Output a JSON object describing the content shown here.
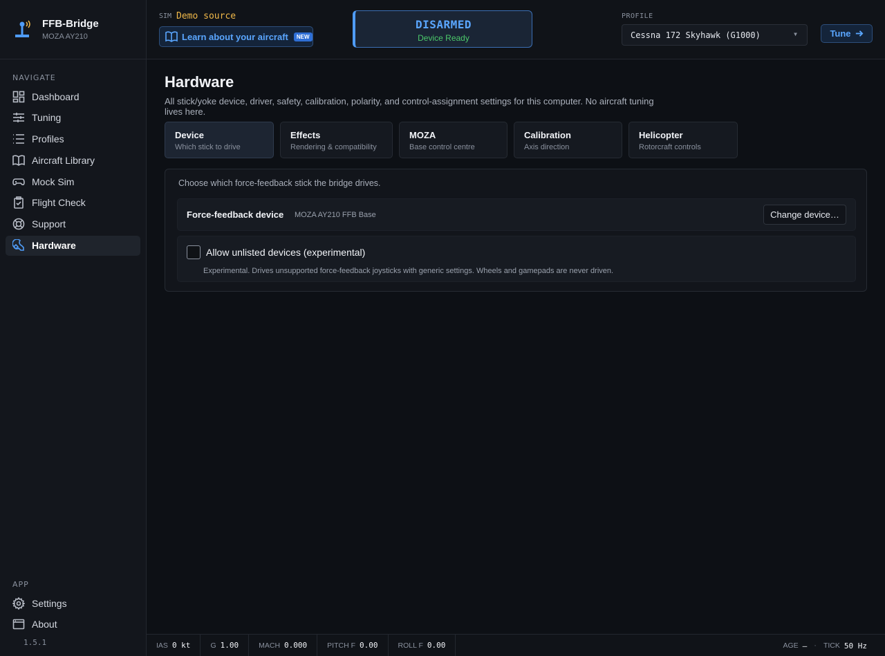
{
  "brand": {
    "title": "FFB-Bridge",
    "subtitle": "MOZA AY210"
  },
  "sidebar": {
    "navigate_label": "NAVIGATE",
    "items": [
      {
        "label": "Dashboard",
        "icon": "dashboard-icon"
      },
      {
        "label": "Tuning",
        "icon": "sliders-icon"
      },
      {
        "label": "Profiles",
        "icon": "list-icon"
      },
      {
        "label": "Aircraft Library",
        "icon": "book-icon"
      },
      {
        "label": "Mock Sim",
        "icon": "gamepad-icon"
      },
      {
        "label": "Flight Check",
        "icon": "clipboard-check-icon"
      },
      {
        "label": "Support",
        "icon": "lifebuoy-icon"
      },
      {
        "label": "Hardware",
        "icon": "wrench-icon",
        "active": true
      }
    ],
    "app_label": "APP",
    "app_items": [
      {
        "label": "Settings",
        "icon": "gear-icon"
      },
      {
        "label": "About",
        "icon": "window-icon"
      }
    ],
    "version": "1.5.1"
  },
  "topbar": {
    "sim_label": "SIM",
    "sim_value": "Demo source",
    "learn_label": "Learn about your aircraft",
    "new_badge": "NEW",
    "status_main": "DISARMED",
    "status_sub": "Device Ready",
    "profile_label": "PROFILE",
    "profile_value": "Cessna 172 Skyhawk (G1000)",
    "tune_label": "Tune"
  },
  "page": {
    "title": "Hardware",
    "description": "All stick/yoke device, driver, safety, calibration, polarity, and control-assignment settings for this computer. No aircraft tuning lives here.",
    "tabs": [
      {
        "title": "Device",
        "sub": "Which stick to drive",
        "active": true
      },
      {
        "title": "Effects",
        "sub": "Rendering & compatibility"
      },
      {
        "title": "MOZA",
        "sub": "Base control centre"
      },
      {
        "title": "Calibration",
        "sub": "Axis direction"
      },
      {
        "title": "Helicopter",
        "sub": "Rotorcraft controls"
      }
    ],
    "card": {
      "intro": "Choose which force-feedback stick the bridge drives.",
      "device_label": "Force-feedback device",
      "device_value": "MOZA AY210 FFB Base",
      "change_label": "Change device…",
      "unlisted_label": "Allow unlisted devices (experimental)",
      "unlisted_checked": false,
      "unlisted_help": "Experimental. Drives unsupported force-feedback joysticks with generic settings. Wheels and gamepads are never driven."
    }
  },
  "footer": {
    "stats": [
      {
        "key": "IAS",
        "value": "0 kt"
      },
      {
        "key": "G",
        "value": "1.00"
      },
      {
        "key": "MACH",
        "value": "0.000"
      },
      {
        "key": "PITCH F",
        "value": "0.00"
      },
      {
        "key": "ROLL F",
        "value": "0.00"
      }
    ],
    "age_key": "AGE",
    "age_value": "—",
    "separator": "·",
    "tick_key": "TICK",
    "tick_value": "50 Hz"
  },
  "colors": {
    "accent": "#4f9cf7",
    "warning": "#f0b849",
    "ok": "#4cc96b",
    "background": "#0d1015"
  }
}
